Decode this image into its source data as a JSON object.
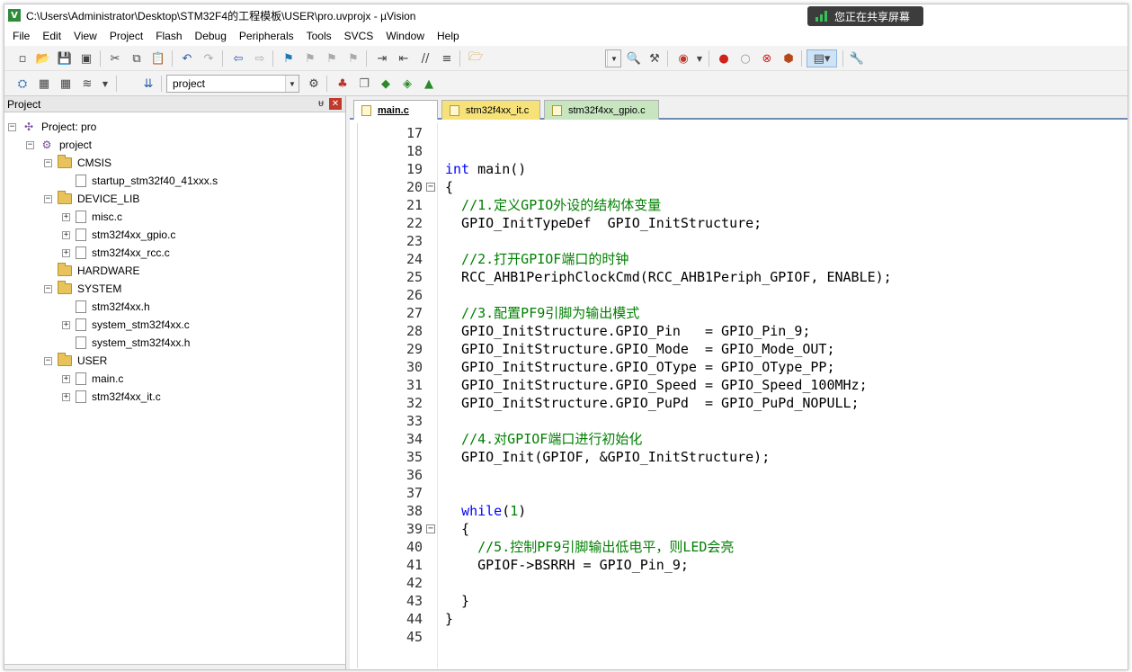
{
  "window": {
    "title": "C:\\Users\\Administrator\\Desktop\\STM32F4的工程模板\\USER\\pro.uvprojx - µVision",
    "app_icon": "V"
  },
  "share_badge": {
    "text": "您正在共享屏幕",
    "color": "#36c25a"
  },
  "menu": [
    "File",
    "Edit",
    "View",
    "Project",
    "Flash",
    "Debug",
    "Peripherals",
    "Tools",
    "SVCS",
    "Window",
    "Help"
  ],
  "toolbar2": {
    "target": "project"
  },
  "project_panel": {
    "title": "Project",
    "tree": [
      {
        "label": "Project: pro",
        "type": "project"
      },
      {
        "label": "project",
        "type": "group"
      },
      {
        "label": "CMSIS",
        "type": "folder"
      },
      {
        "label": "startup_stm32f40_41xxx.s",
        "type": "file"
      },
      {
        "label": "DEVICE_LIB",
        "type": "folder"
      },
      {
        "label": "misc.c",
        "type": "file"
      },
      {
        "label": "stm32f4xx_gpio.c",
        "type": "file"
      },
      {
        "label": "stm32f4xx_rcc.c",
        "type": "file"
      },
      {
        "label": "HARDWARE",
        "type": "folder"
      },
      {
        "label": "SYSTEM",
        "type": "folder"
      },
      {
        "label": "stm32f4xx.h",
        "type": "file"
      },
      {
        "label": "system_stm32f4xx.c",
        "type": "file"
      },
      {
        "label": "system_stm32f4xx.h",
        "type": "file"
      },
      {
        "label": "USER",
        "type": "folder"
      },
      {
        "label": "main.c",
        "type": "file"
      },
      {
        "label": "stm32f4xx_it.c",
        "type": "file"
      }
    ]
  },
  "editor": {
    "tabs": [
      {
        "label": "main.c",
        "active": true
      },
      {
        "label": "stm32f4xx_it.c",
        "active": false
      },
      {
        "label": "stm32f4xx_gpio.c",
        "active": false
      }
    ],
    "lines": [
      {
        "n": "17",
        "segs": []
      },
      {
        "n": "18",
        "segs": []
      },
      {
        "n": "19",
        "segs": [
          {
            "t": "int",
            "c": "kw"
          },
          {
            "t": " main()",
            "c": ""
          }
        ]
      },
      {
        "n": "20",
        "fold": "⊟",
        "segs": [
          {
            "t": "{",
            "c": ""
          }
        ]
      },
      {
        "n": "21",
        "segs": [
          {
            "t": "  //1.定义GPIO外设的结构体变量",
            "c": "cmt"
          }
        ]
      },
      {
        "n": "22",
        "segs": [
          {
            "t": "  GPIO_InitTypeDef  GPIO_InitStructure;",
            "c": ""
          }
        ]
      },
      {
        "n": "23",
        "segs": []
      },
      {
        "n": "24",
        "segs": [
          {
            "t": "  //2.打开GPIOF端口的时钟",
            "c": "cmt"
          }
        ]
      },
      {
        "n": "25",
        "segs": [
          {
            "t": "  RCC_AHB1PeriphClockCmd(RCC_AHB1Periph_GPIOF, ENABLE);",
            "c": ""
          }
        ]
      },
      {
        "n": "26",
        "segs": []
      },
      {
        "n": "27",
        "segs": [
          {
            "t": "  //3.配置PF9引脚为输出模式",
            "c": "cmt"
          }
        ]
      },
      {
        "n": "28",
        "segs": [
          {
            "t": "  GPIO_InitStructure.GPIO_Pin   = GPIO_Pin_9;",
            "c": ""
          }
        ]
      },
      {
        "n": "29",
        "segs": [
          {
            "t": "  GPIO_InitStructure.GPIO_Mode  = GPIO_Mode_OUT;",
            "c": ""
          }
        ]
      },
      {
        "n": "30",
        "segs": [
          {
            "t": "  GPIO_InitStructure.GPIO_OType = GPIO_OType_PP;",
            "c": ""
          }
        ]
      },
      {
        "n": "31",
        "segs": [
          {
            "t": "  GPIO_InitStructure.GPIO_Speed = GPIO_Speed_100MHz;",
            "c": ""
          }
        ]
      },
      {
        "n": "32",
        "segs": [
          {
            "t": "  GPIO_InitStructure.GPIO_PuPd  = GPIO_PuPd_NOPULL;",
            "c": ""
          }
        ]
      },
      {
        "n": "33",
        "segs": []
      },
      {
        "n": "34",
        "segs": [
          {
            "t": "  //4.对GPIOF端口进行初始化",
            "c": "cmt"
          }
        ]
      },
      {
        "n": "35",
        "segs": [
          {
            "t": "  GPIO_Init(GPIOF, &GPIO_InitStructure);",
            "c": ""
          }
        ]
      },
      {
        "n": "36",
        "segs": []
      },
      {
        "n": "37",
        "segs": []
      },
      {
        "n": "38",
        "segs": [
          {
            "t": "  ",
            "c": ""
          },
          {
            "t": "while",
            "c": "kw"
          },
          {
            "t": "(",
            "c": ""
          },
          {
            "t": "1",
            "c": "num"
          },
          {
            "t": ")",
            "c": ""
          }
        ]
      },
      {
        "n": "39",
        "fold": "⊟",
        "segs": [
          {
            "t": "  {",
            "c": ""
          }
        ]
      },
      {
        "n": "40",
        "segs": [
          {
            "t": "    //5.控制PF9引脚输出低电平，则LED会亮",
            "c": "cmt"
          }
        ]
      },
      {
        "n": "41",
        "segs": [
          {
            "t": "    GPIOF->BSRRH = GPIO_Pin_9;",
            "c": ""
          }
        ]
      },
      {
        "n": "42",
        "segs": []
      },
      {
        "n": "43",
        "segs": [
          {
            "t": "  }",
            "c": ""
          }
        ]
      },
      {
        "n": "44",
        "segs": [
          {
            "t": "}",
            "c": ""
          }
        ]
      },
      {
        "n": "45",
        "segs": []
      }
    ]
  }
}
